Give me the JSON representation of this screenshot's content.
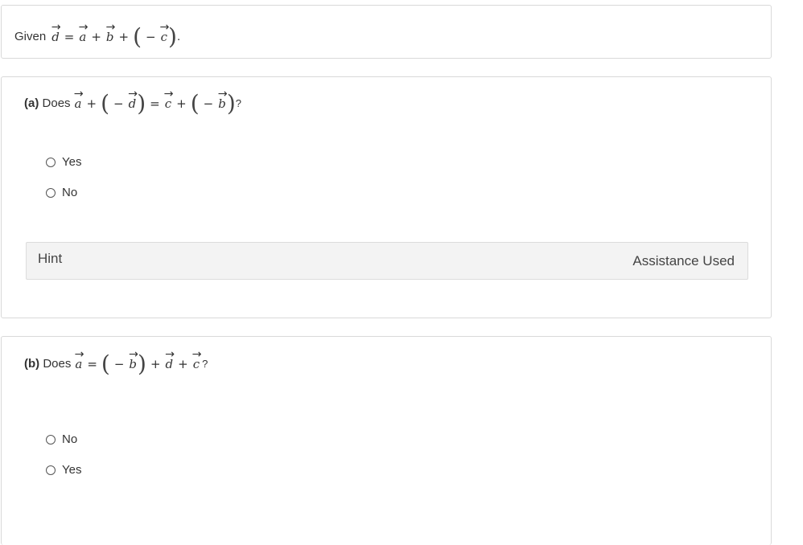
{
  "given": {
    "label": "Given",
    "vars": {
      "d": "d",
      "a": "a",
      "b": "b",
      "c": "c"
    },
    "ops": {
      "eq": "=",
      "plus": "+",
      "minus": "−"
    },
    "end": "."
  },
  "question_a": {
    "part": "(a)",
    "prompt": "Does",
    "end": "?",
    "options": [
      {
        "label": "Yes",
        "selected": false
      },
      {
        "label": "No",
        "selected": false
      }
    ],
    "hint": {
      "label": "Hint",
      "status": "Assistance Used"
    }
  },
  "question_b": {
    "part": "(b)",
    "prompt": "Does",
    "end": "?",
    "options": [
      {
        "label": "No",
        "selected": false
      },
      {
        "label": "Yes",
        "selected": false
      }
    ]
  }
}
